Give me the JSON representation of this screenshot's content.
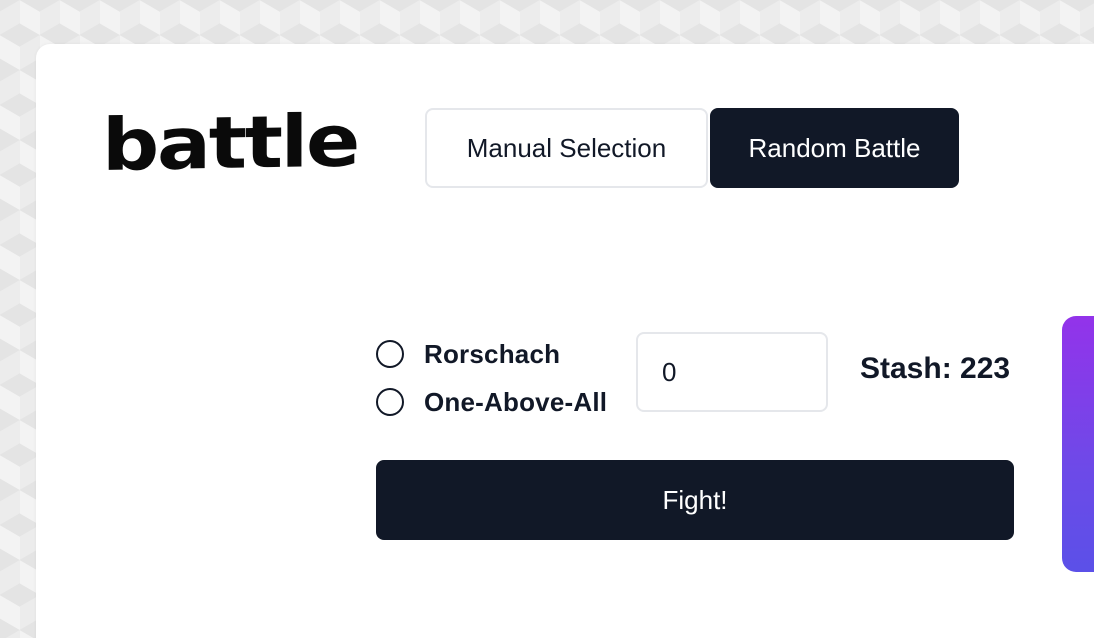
{
  "logo": {
    "text": "battle"
  },
  "mode_switch": {
    "manual_label": "Manual Selection",
    "random_label": "Random Battle",
    "active": "random"
  },
  "fighters": {
    "options": [
      {
        "label": "Rorschach",
        "selected": false
      },
      {
        "label": "One-Above-All",
        "selected": false
      }
    ]
  },
  "bet": {
    "value": "0"
  },
  "stash": {
    "label": "Stash: 223"
  },
  "fight_button": {
    "label": "Fight!"
  },
  "colors": {
    "primary": "#111827",
    "border": "#e5e7eb",
    "accent_gradient_top": "#9333ea",
    "accent_gradient_bottom": "#5b50e8"
  }
}
